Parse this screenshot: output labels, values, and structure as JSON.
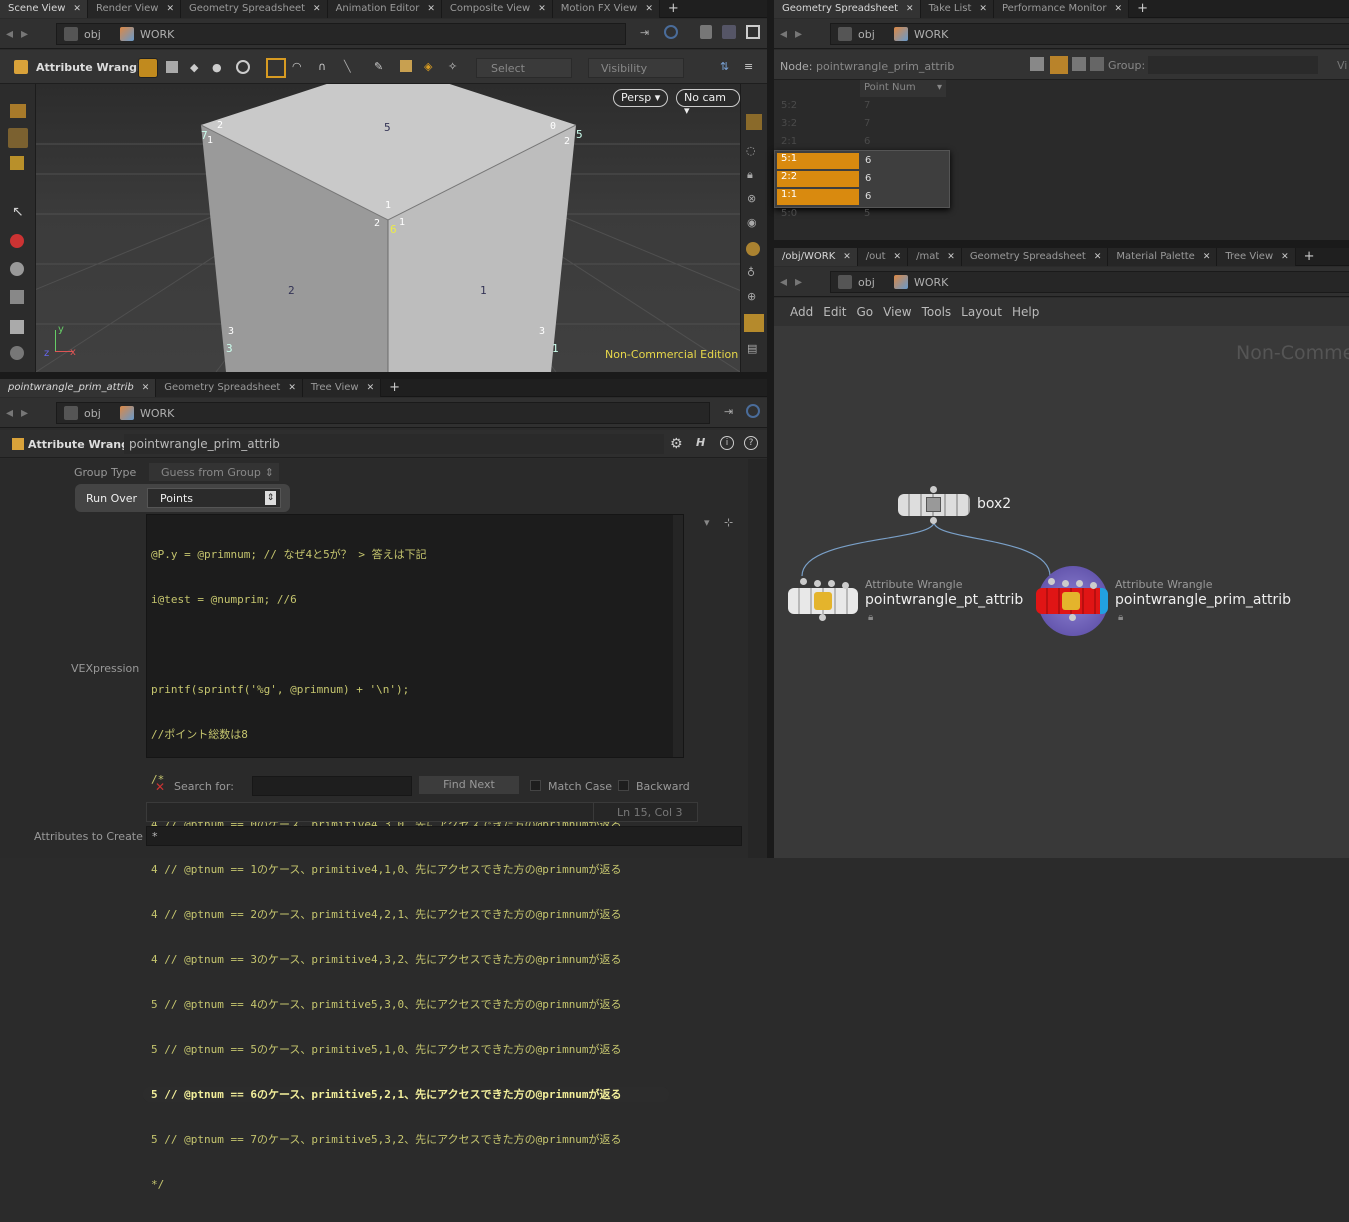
{
  "left_tabs": {
    "items": [
      "Scene View",
      "Render View",
      "Geometry Spreadsheet",
      "Animation Editor",
      "Composite View",
      "Motion FX View"
    ]
  },
  "left_path": {
    "seg1": "obj",
    "seg2": "WORK"
  },
  "viewer_toolbar": {
    "node_type": "Attribute Wrangle",
    "select": "Select",
    "visibility": "Visibility"
  },
  "viewport": {
    "persp": "Persp",
    "cam": "No cam",
    "watermark": "Non-Commercial Edition",
    "axis_y": "y",
    "axis_x": "x",
    "axis_z": "z",
    "labels": [
      "2",
      "7",
      "1",
      "5",
      "0",
      "2",
      "5",
      "1",
      "2",
      "6",
      "1",
      "2",
      "1",
      "3",
      "3",
      "3",
      "1"
    ]
  },
  "bl_tabs": {
    "items": [
      "pointwrangle_prim_attrib",
      "Geometry Spreadsheet",
      "Tree View"
    ]
  },
  "bl_path": {
    "seg1": "obj",
    "seg2": "WORK"
  },
  "params": {
    "node_type": "Attribute Wrangle",
    "node_name": "pointwrangle_prim_attrib",
    "group_type_label": "Group Type",
    "group_type_value": "Guess from Group",
    "run_over_label": "Run Over",
    "run_over_value": "Points",
    "vex_label": "VEXpression",
    "search_label": "Search for:",
    "find_next": "Find Next",
    "match_case": "Match Case",
    "backward": "Backward",
    "ln_col": "Ln 15, Col 3",
    "attrs_label": "Attributes to Create",
    "attrs_value": "*"
  },
  "code": [
    "@P.y = @primnum; // なぜ4と5が？ > 答えは下記",
    "i@test = @numprim; //6",
    "",
    "printf(sprintf('%g', @primnum) + '\\n');",
    "//ポイント総数は8",
    "/*",
    "4 // @ptnum == 0のケース、primitive4,3,0、先にアクセスできた方の@primnumが返る",
    "4 // @ptnum == 1のケース、primitive4,1,0、先にアクセスできた方の@primnumが返る",
    "4 // @ptnum == 2のケース、primitive4,2,1、先にアクセスできた方の@primnumが返る",
    "4 // @ptnum == 3のケース、primitive4,3,2、先にアクセスできた方の@primnumが返る",
    "5 // @ptnum == 4のケース、primitive5,3,0、先にアクセスできた方の@primnumが返る",
    "5 // @ptnum == 5のケース、primitive5,1,0、先にアクセスできた方の@primnumが返る",
    "5 // @ptnum == 6のケース、primitive5,2,1、先にアクセスできた方の@primnumが返る",
    "5 // @ptnum == 7のケース、primitive5,3,2、先にアクセスできた方の@primnumが返る",
    "*/"
  ],
  "tr_tabs": {
    "items": [
      "Geometry Spreadsheet",
      "Take List",
      "Performance Monitor"
    ]
  },
  "tr_path": {
    "seg1": "obj",
    "seg2": "WORK"
  },
  "spreadsheet": {
    "node_label": "Node:",
    "node_name": "pointwrangle_prim_attrib",
    "group_label": "Group:",
    "vi": "Vi",
    "col_header": "Point Num",
    "rows": [
      {
        "id": "5:2",
        "val": "7"
      },
      {
        "id": "3:2",
        "val": "7"
      },
      {
        "id": "2:1",
        "val": "6"
      },
      {
        "id": "5:1",
        "val": "6"
      },
      {
        "id": "2:2",
        "val": "6"
      },
      {
        "id": "1:1",
        "val": "6"
      },
      {
        "id": "5:0",
        "val": "5"
      }
    ]
  },
  "br_tabs": {
    "items": [
      "/obj/WORK",
      "/out",
      "/mat",
      "Geometry Spreadsheet",
      "Material Palette",
      "Tree View"
    ]
  },
  "br_path": {
    "seg1": "obj",
    "seg2": "WORK"
  },
  "menu": {
    "items": [
      "Add",
      "Edit",
      "Go",
      "View",
      "Tools",
      "Layout",
      "Help"
    ]
  },
  "network": {
    "watermark": "Non-Comme",
    "box_name": "box2",
    "n1_type": "Attribute Wrangle",
    "n1_name": "pointwrangle_pt_attrib",
    "n2_type": "Attribute Wrangle",
    "n2_name": "pointwrangle_prim_attrib"
  }
}
